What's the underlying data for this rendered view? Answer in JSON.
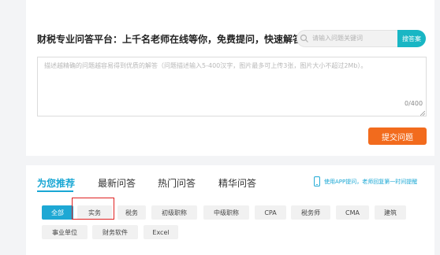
{
  "header": {
    "title": "财税专业问答平台：上千名老师在线等你，免费提问，快速解答"
  },
  "search": {
    "placeholder": "请输入问题关键词",
    "button_label": "搜答案"
  },
  "question_box": {
    "placeholder": "描述越精确的问题越容易得到优质的解答（问题描述输入5-400汉字，图片最多可上传3张，图片大小不超过2Mb）。",
    "counter": "0/400",
    "submit_label": "提交问题"
  },
  "tabs": [
    {
      "label": "为您推荐",
      "active": true
    },
    {
      "label": "最新问答",
      "active": false
    },
    {
      "label": "热门问答",
      "active": false
    },
    {
      "label": "精华问答",
      "active": false
    }
  ],
  "app_tip": "使用APP提问，老师回复第一时间提醒",
  "tags": [
    "全部",
    "实务",
    "税务",
    "初级职称",
    "中级职称",
    "CPA",
    "税务师",
    "CMA",
    "建筑",
    "事业单位",
    "财务软件",
    "Excel"
  ],
  "colors": {
    "accent": "#19a7d4",
    "search_button": "#19b6c4",
    "submit_button": "#f26b1d",
    "highlight": "#e02020"
  }
}
